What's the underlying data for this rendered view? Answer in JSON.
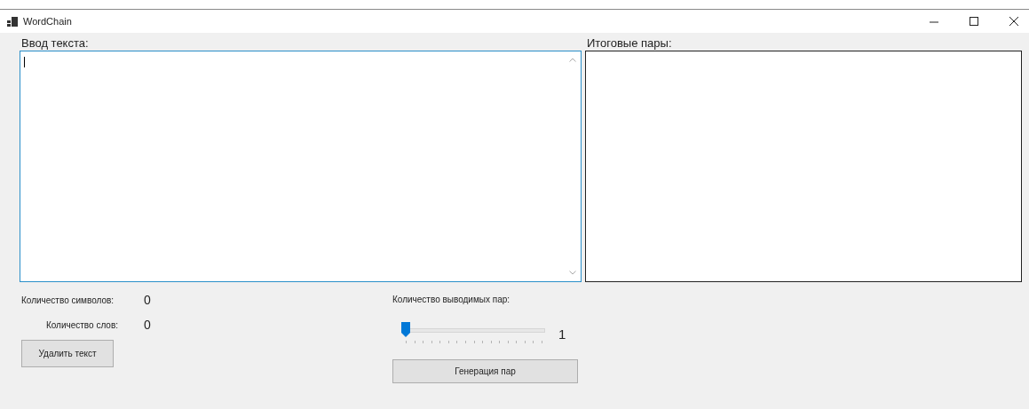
{
  "window": {
    "title": "WordChain"
  },
  "input_text": {
    "label": "Ввод текста:",
    "focused": true
  },
  "output_pairs": {
    "label": "Итоговые пары:"
  },
  "stats": [
    {
      "label": "Количество символов:",
      "value": "0"
    },
    {
      "label": "Количество слов:",
      "value": "0"
    }
  ],
  "delete_button": "Удалить текст",
  "pairs_count": {
    "label": "Количество выводимых пар:",
    "level": 0,
    "reading": "1"
  },
  "generate_button": "Генерация пар"
}
